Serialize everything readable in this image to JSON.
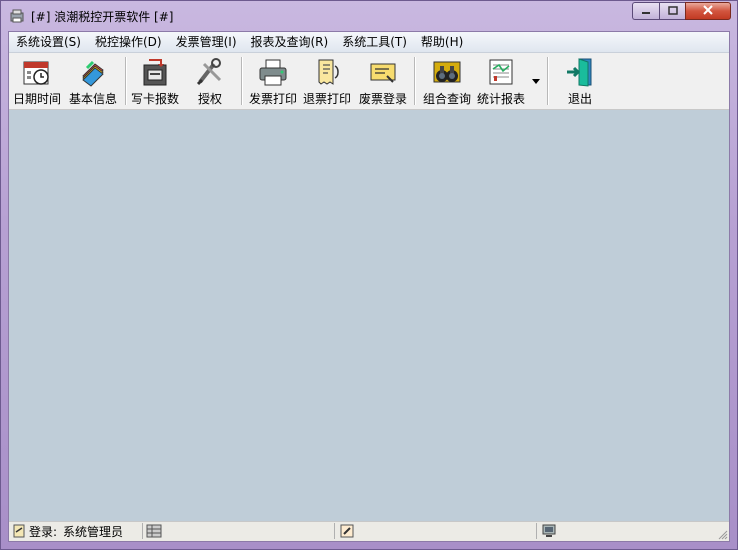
{
  "window": {
    "title": "[#] 浪潮税控开票软件 [#]"
  },
  "menu": [
    {
      "label": "系统设置(S)"
    },
    {
      "label": "税控操作(D)"
    },
    {
      "label": "发票管理(I)"
    },
    {
      "label": "报表及查询(R)"
    },
    {
      "label": "系统工具(T)"
    },
    {
      "label": "帮助(H)"
    }
  ],
  "toolbar": {
    "date_time": "日期时间",
    "basic_info": "基本信息",
    "write_card": "写卡报数",
    "authorize": "授权",
    "invoice_print": "发票打印",
    "refund_print": "退票打印",
    "void_register": "废票登录",
    "combined_query": "组合查询",
    "stat_report": "统计报表",
    "exit": "退出"
  },
  "status": {
    "login_label": "登录:",
    "login_user": "系统管理员"
  },
  "colors": {
    "workspace": "#bfcdd8",
    "frame": "#b39ccf"
  }
}
